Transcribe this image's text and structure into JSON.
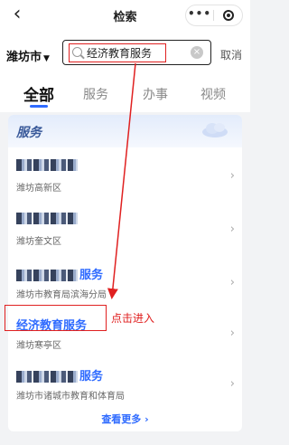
{
  "nav": {
    "back_icon": "back-chevron-icon",
    "title": "检索",
    "more_label": "•••"
  },
  "search": {
    "city": "潍坊市",
    "query": "经济教育服务",
    "cancel": "取消"
  },
  "tabs": [
    "全部",
    "服务",
    "办事",
    "视频"
  ],
  "section": {
    "title": "服务"
  },
  "results": [
    {
      "title_suffix": "",
      "subtitle": "潍坊高新区"
    },
    {
      "title_suffix": "",
      "subtitle": "潍坊奎文区"
    },
    {
      "title_suffix": "服务",
      "subtitle": "潍坊市教育局滨海分局"
    },
    {
      "title": "经济教育服务",
      "subtitle": "潍坊寒亭区"
    },
    {
      "title_suffix": "服务",
      "subtitle": "潍坊市诸城市教育和体育局"
    }
  ],
  "annotation": "点击进入",
  "see_more": "查看更多",
  "colors": {
    "accent": "#2f6bff",
    "annotation": "#e02020"
  }
}
